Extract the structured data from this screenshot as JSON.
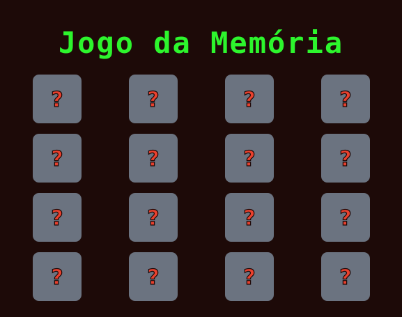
{
  "title": "Jogo da Memória",
  "card_back_symbol": "?",
  "colors": {
    "background": "#1d0a08",
    "title": "#2df52d",
    "card": "#6b7380",
    "symbol": "#e8412e"
  },
  "grid": {
    "rows": 4,
    "columns": 4
  },
  "cards": [
    {
      "state": "hidden",
      "icon": "question-mark-icon"
    },
    {
      "state": "hidden",
      "icon": "question-mark-icon"
    },
    {
      "state": "hidden",
      "icon": "question-mark-icon"
    },
    {
      "state": "hidden",
      "icon": "question-mark-icon"
    },
    {
      "state": "hidden",
      "icon": "question-mark-icon"
    },
    {
      "state": "hidden",
      "icon": "question-mark-icon"
    },
    {
      "state": "hidden",
      "icon": "question-mark-icon"
    },
    {
      "state": "hidden",
      "icon": "question-mark-icon"
    },
    {
      "state": "hidden",
      "icon": "question-mark-icon"
    },
    {
      "state": "hidden",
      "icon": "question-mark-icon"
    },
    {
      "state": "hidden",
      "icon": "question-mark-icon"
    },
    {
      "state": "hidden",
      "icon": "question-mark-icon"
    },
    {
      "state": "hidden",
      "icon": "question-mark-icon"
    },
    {
      "state": "hidden",
      "icon": "question-mark-icon"
    },
    {
      "state": "hidden",
      "icon": "question-mark-icon"
    },
    {
      "state": "hidden",
      "icon": "question-mark-icon"
    }
  ]
}
